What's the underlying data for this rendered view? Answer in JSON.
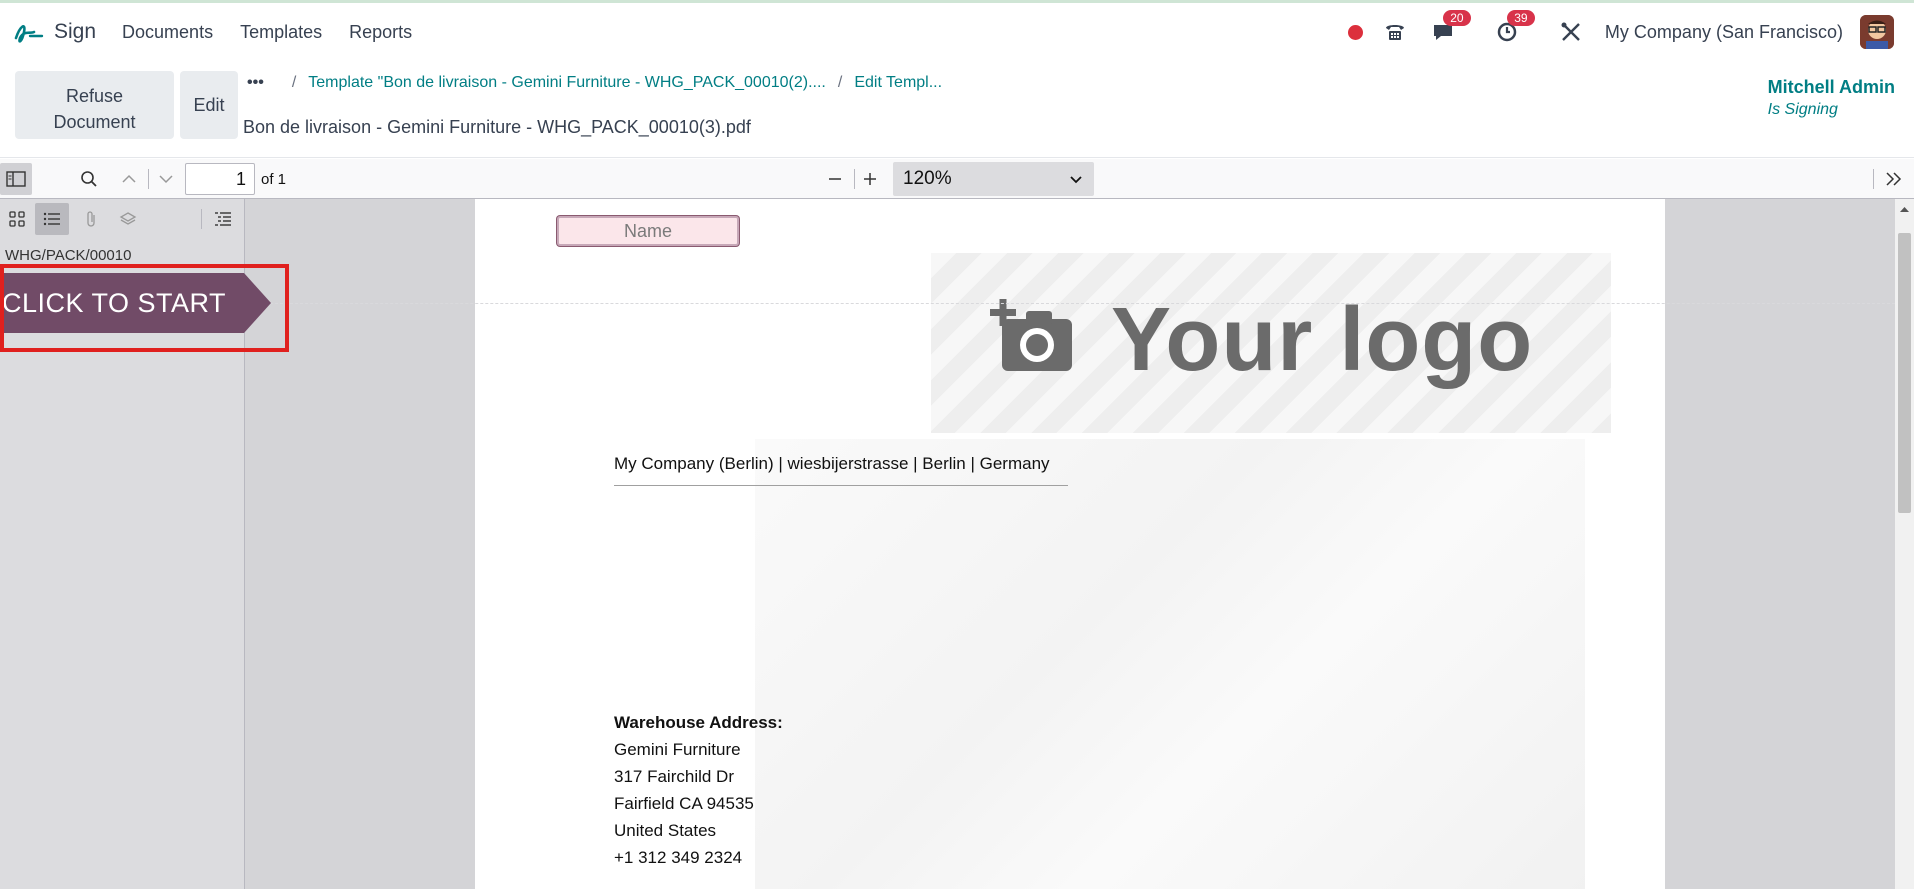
{
  "app": {
    "name": "Sign",
    "menu": [
      "Documents",
      "Templates",
      "Reports"
    ],
    "messages_badge": "20",
    "activities_badge": "39",
    "company": "My Company (San Francisco)"
  },
  "control": {
    "refuse_line1": "Refuse",
    "refuse_line2": "Document",
    "edit_label": "Edit",
    "breadcrumb_more": "•••",
    "breadcrumb_template": "Template \"Bon de livraison - Gemini Furniture - WHG_PACK_00010(2)....",
    "breadcrumb_edit": "Edit Templ...",
    "document_title": "Bon de livraison - Gemini Furniture - WHG_PACK_00010(3).pdf",
    "signer_name": "Mitchell Admin",
    "signer_status": "Is Signing"
  },
  "pdf_toolbar": {
    "page_number": "1",
    "page_total": "of 1",
    "zoom": "120%"
  },
  "sidebar": {
    "outline_item": "WHG/PACK/00010"
  },
  "document": {
    "name_field_placeholder": "Name",
    "logo_text": "Your logo",
    "company_line": "My Company (Berlin) | wiesbijerstrasse | Berlin | Germany",
    "warehouse_title": "Warehouse Address:",
    "address_lines": [
      "Gemini Furniture",
      "317 Fairchild Dr",
      "Fairfield CA 94535",
      "United States",
      "+1 312 349 2324"
    ]
  },
  "start_flag": {
    "label": "CLICK TO START",
    "color": "#714b67",
    "highlight_color": "#e0201e"
  },
  "colors": {
    "accent": "#017e84",
    "badge": "#d8334a",
    "record": "#dc2f3c"
  }
}
